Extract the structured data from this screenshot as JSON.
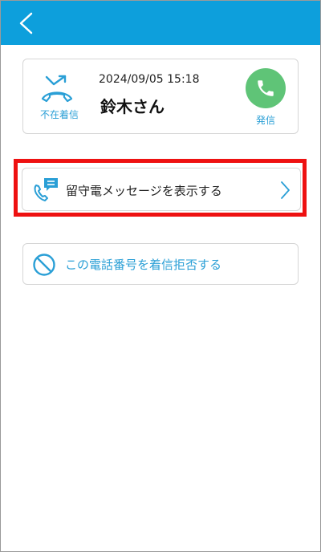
{
  "call": {
    "missed_label": "不在着信",
    "datetime": "2024/09/05 15:18",
    "caller": "鈴木さん",
    "dial_label": "発信"
  },
  "actions": {
    "voicemail_label": "留守電メッセージを表示する",
    "block_label": "この電話番号を着信拒否する"
  },
  "colors": {
    "header": "#0d9fdc",
    "accent": "#2a9fd6",
    "dial_button": "#5fc477",
    "highlight": "#ee1111"
  },
  "icons": [
    "back-arrow-icon",
    "missed-call-icon",
    "phone-icon",
    "voicemail-message-icon",
    "chevron-right-icon",
    "block-icon"
  ]
}
